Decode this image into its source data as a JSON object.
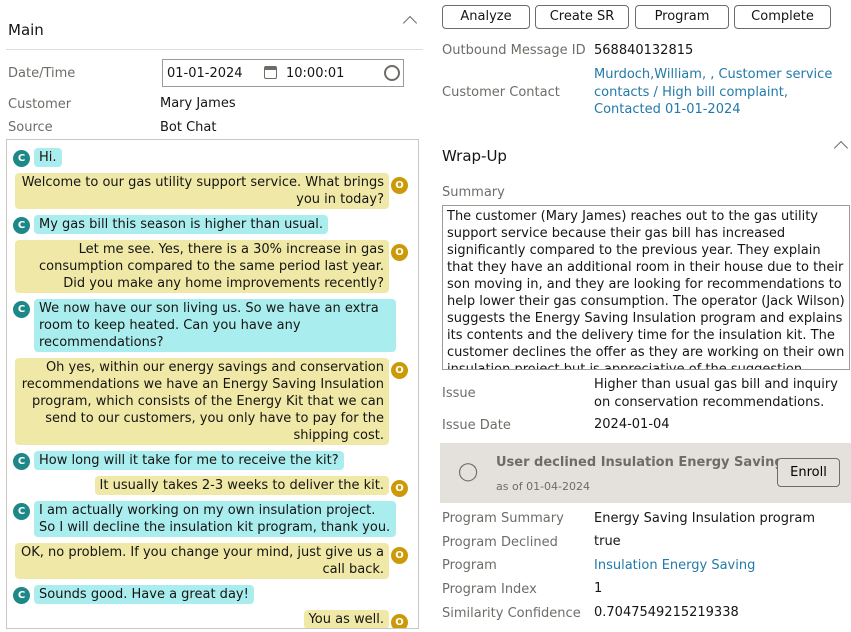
{
  "toolbar": {
    "analyze": "Analyze",
    "create_sr": "Create SR",
    "program": "Program",
    "complete": "Complete"
  },
  "main": {
    "title": "Main",
    "date_label": "Date/Time",
    "date": "01-01-2024",
    "time": "10:00:01",
    "customer_label": "Customer",
    "customer": "Mary James",
    "source_label": "Source",
    "source": "Bot Chat"
  },
  "chat": [
    {
      "from": "C",
      "text": "Hi."
    },
    {
      "from": "O",
      "text": "Welcome to our gas utility support service. What brings you in today?"
    },
    {
      "from": "C",
      "text": "My gas bill this season is higher than usual."
    },
    {
      "from": "O",
      "text": "Let me see. Yes, there is a 30% increase in gas consumption compared to the same period last year. Did you make any home improvements recently?"
    },
    {
      "from": "C",
      "text": "We now have our son living us. So we have an extra room to keep heated. Can you have any recommendations?"
    },
    {
      "from": "O",
      "text": "Oh yes, within our energy savings and conservation recommendations we have an Energy Saving Insulation program, which consists of the Energy Kit that we can send to our customers, you only have to pay for the shipping cost."
    },
    {
      "from": "C",
      "text": "How long will it take for me to receive the kit?"
    },
    {
      "from": "O",
      "text": "It usually takes 2-3 weeks to deliver the kit."
    },
    {
      "from": "C",
      "text": "I am actually working on my own insulation project. So I will decline the insulation kit program, thank you."
    },
    {
      "from": "O",
      "text": "OK, no problem. If you change your mind, just give us a call back."
    },
    {
      "from": "C",
      "text": "Sounds good. Have a great day!"
    },
    {
      "from": "O",
      "text": "You as well."
    }
  ],
  "info": {
    "outbound_label": "Outbound Message ID",
    "outbound": "568840132815",
    "contact_label": "Customer Contact",
    "contact": "Murdoch,William, , Customer service contacts / High bill complaint, Contacted 01-01-2024"
  },
  "wrapup": {
    "title": "Wrap-Up",
    "summary_label": "Summary",
    "summary": "The customer (Mary James) reaches out to the gas utility support service because their gas bill has increased significantly compared to the previous year. They explain that they have an additional room in their house due to their son moving in, and they are looking for recommendations to help lower their gas consumption. The operator (Jack Wilson) suggests the Energy Saving Insulation program and explains its contents and the delivery time for the insulation kit. The customer declines the offer as they are working on their own insulation project but is appreciative of the suggestion.",
    "issue_label": "Issue",
    "issue": "Higher than usual gas bill and inquiry on conservation recommendations.",
    "issue_date_label": "Issue Date",
    "issue_date": "2024-01-04"
  },
  "banner": {
    "title": "User declined Insulation Energy Saving",
    "sub": "as of 01-04-2024",
    "enroll": "Enroll"
  },
  "program": {
    "summary_label": "Program Summary",
    "summary": "Energy Saving Insulation program",
    "declined_label": "Program Declined",
    "declined": "true",
    "program_label": "Program",
    "program": "Insulation Energy Saving",
    "index_label": "Program Index",
    "index": "1",
    "sim_label": "Similarity Confidence",
    "sim": "0.7047549215219338"
  }
}
